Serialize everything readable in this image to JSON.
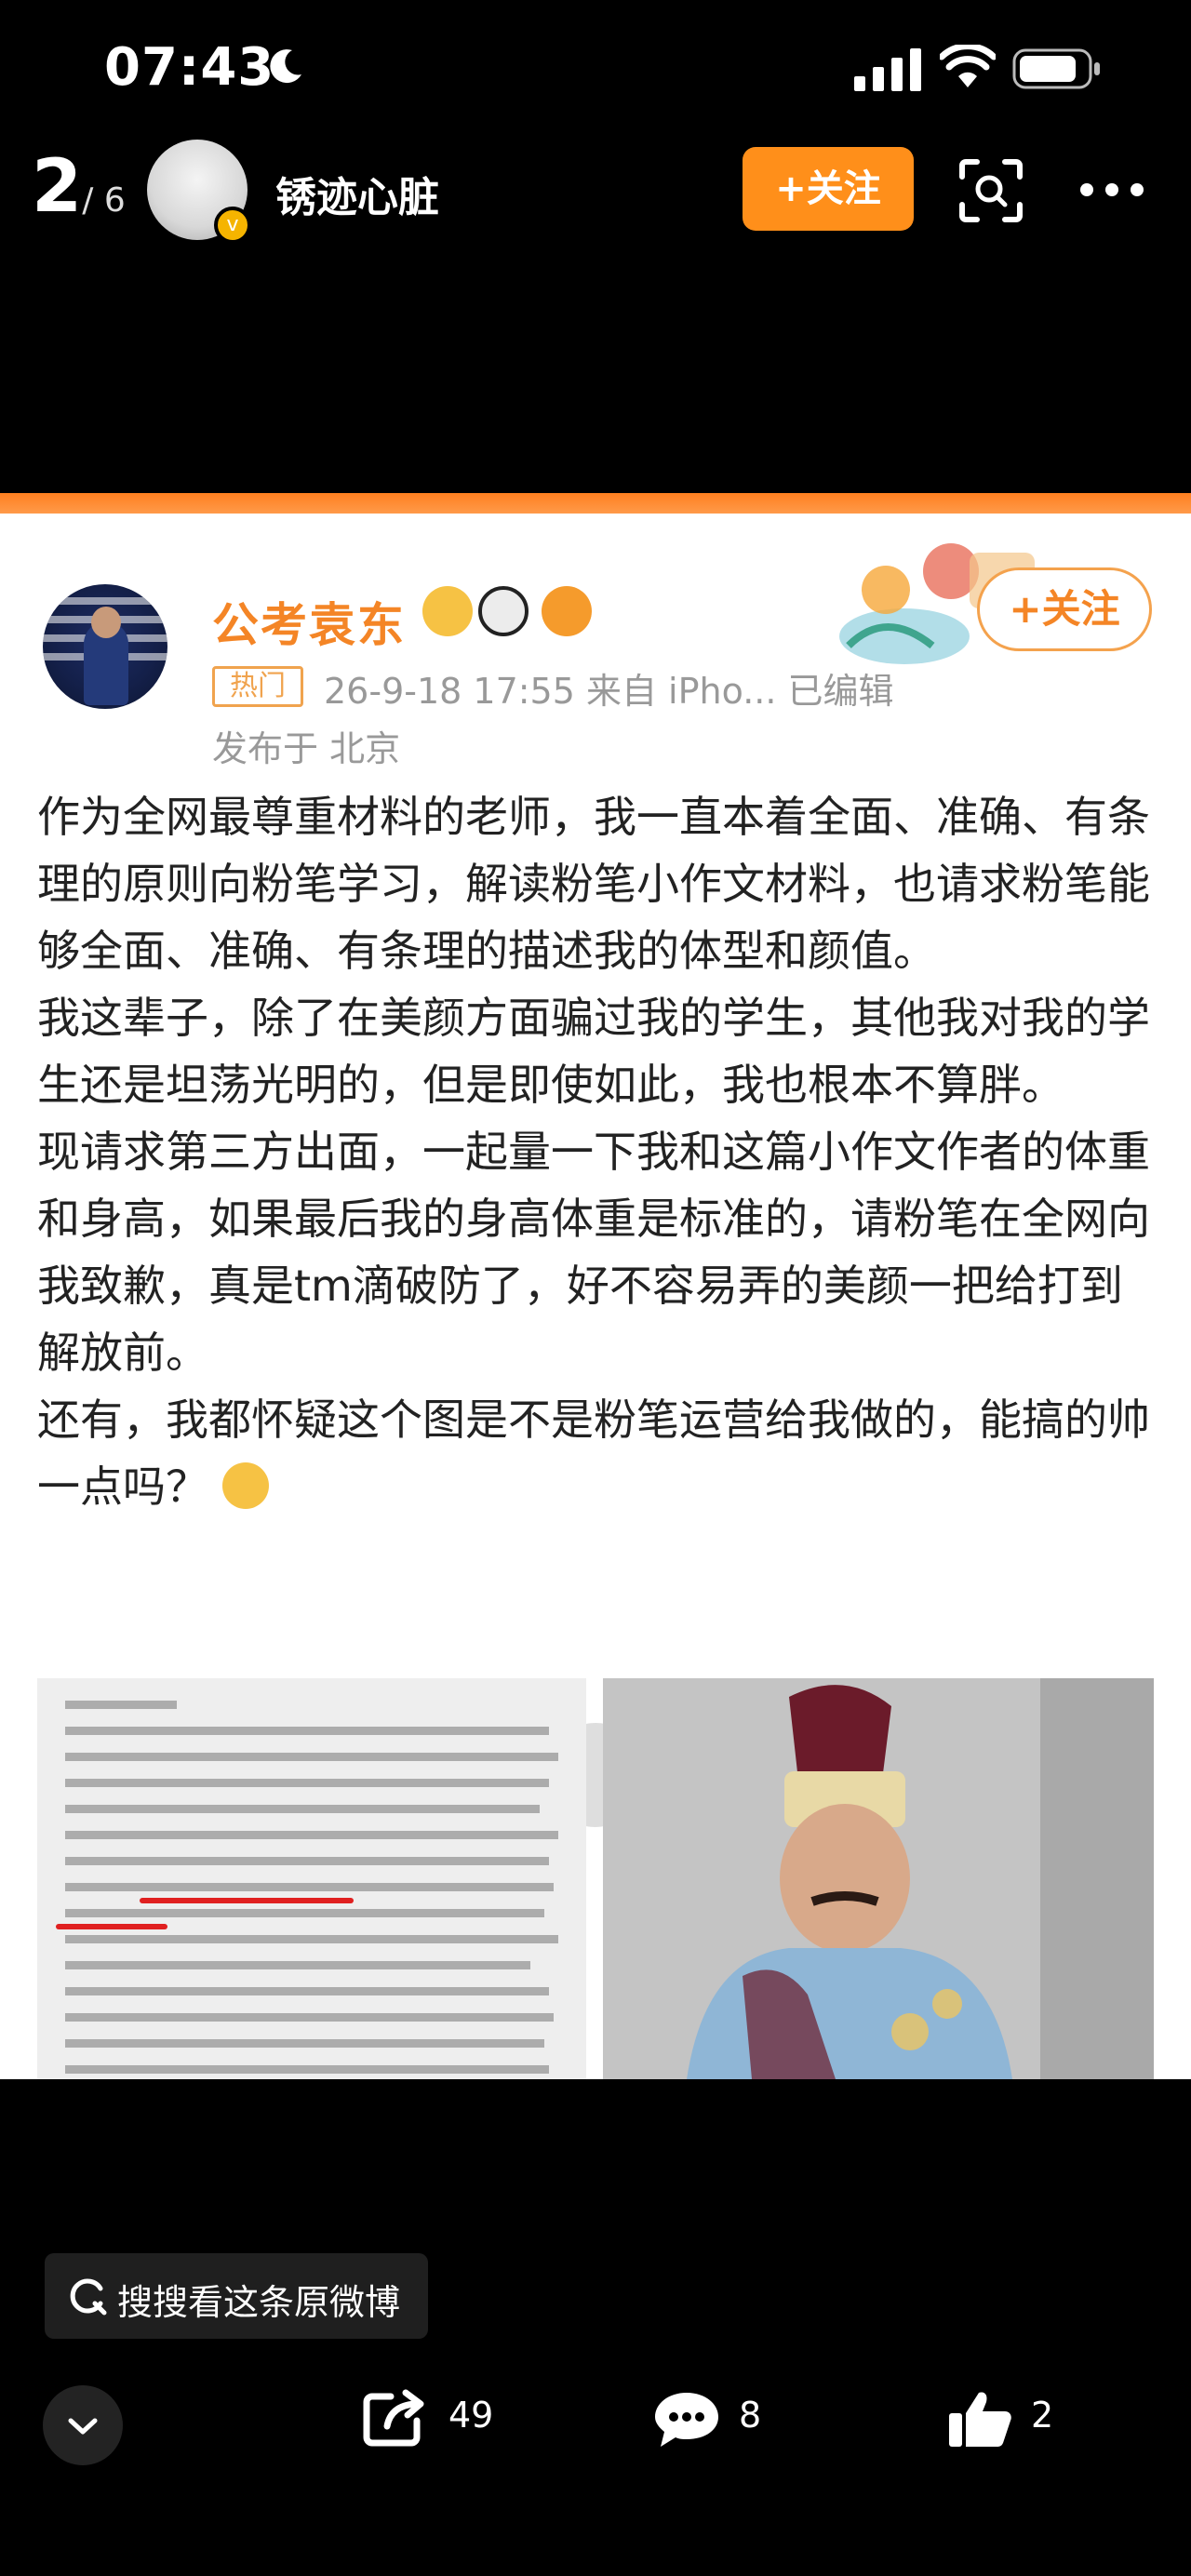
{
  "status_bar": {
    "time": "07:43"
  },
  "header": {
    "page_index": "2",
    "page_total": "/ 6",
    "username": "锈迹心脏",
    "follow_label": "+关注"
  },
  "weibo": {
    "author": "公考袁东",
    "hot_tag": "热门",
    "meta": "26-9-18 17:55  来自 iPho...  已编辑",
    "location": "发布于 北京",
    "follow_label": "+关注",
    "paragraphs": [
      "作为全网最尊重材料的老师，我一直本着全面、准确、有条理的原则向粉笔学习，解读粉笔小作文材料，也请求粉笔能够全面、准确、有条理的描述我的体型和颜值。",
      "我这辈子，除了在美颜方面骗过我的学生，其他我对我的学生还是坦荡光明的，但是即使如此，我也根本不算胖。",
      "现请求第三方出面，一起量一下我和这篇小作文作者的体重和身高，如果最后我的身高体重是标准的，请粉笔在全网向我致歉，真是tm滴破防了，好不容易弄的美颜一把给打到解放前。",
      "还有，我都怀疑这个图是不是粉笔运营给我做的，能搞的帅一点吗？"
    ]
  },
  "bottom": {
    "search_label": "搜搜看这条原微博",
    "share_count": "49",
    "comment_count": "8",
    "like_count": "2"
  },
  "colors": {
    "accent_orange": "#ff8f1a",
    "name_orange": "#f48526",
    "background": "#000000"
  },
  "icons": [
    "moon-icon",
    "signal-icon",
    "wifi-icon",
    "battery-icon",
    "verified-badge-icon",
    "scan-icon",
    "more-icon",
    "search-icon",
    "chevron-down-icon",
    "share-icon",
    "comment-icon",
    "like-icon"
  ]
}
